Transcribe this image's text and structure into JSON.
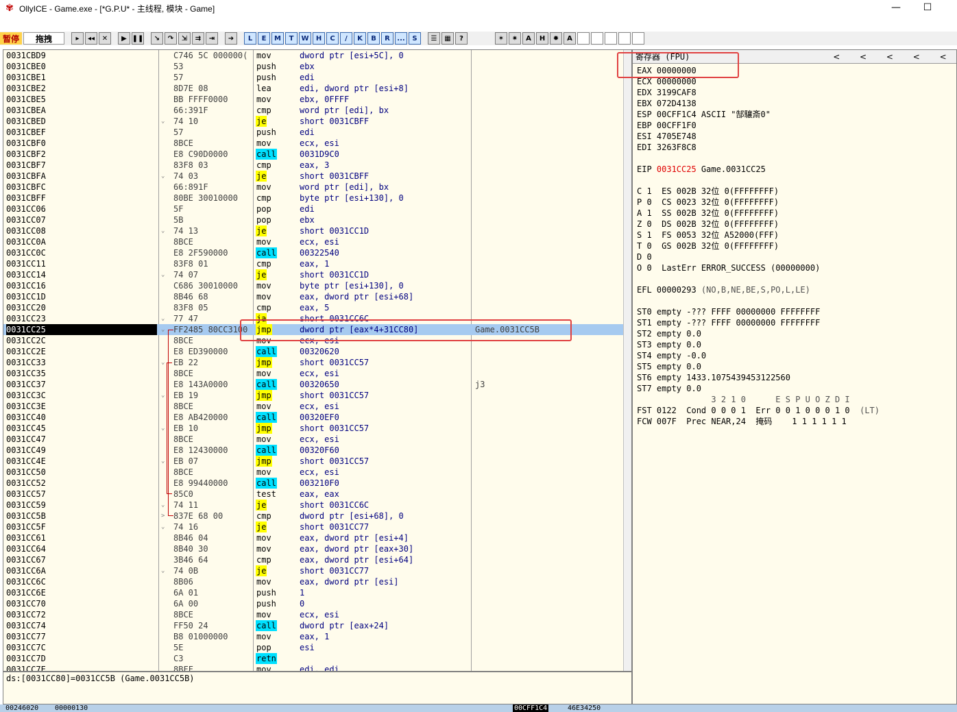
{
  "window": {
    "title": "OllyICE - Game.exe - [*G.P.U* - 主线程, 模块 - Game]",
    "minimize": "—",
    "maximize": "☐"
  },
  "toolbar": {
    "state_label": "暂停",
    "drag_label": "拖拽",
    "letters": [
      "L",
      "E",
      "M",
      "T",
      "W",
      "H",
      "C",
      "/",
      "K",
      "B",
      "R",
      "...",
      "S"
    ]
  },
  "disasm": {
    "rows": [
      {
        "a": "0031CBD9",
        "h": "C746 5C 000000(",
        "m": "mov",
        "o": "dword ptr [esi+5C], 0"
      },
      {
        "a": "0031CBE0",
        "h": "53",
        "m": "push",
        "o": "ebx"
      },
      {
        "a": "0031CBE1",
        "h": "57",
        "m": "push",
        "o": "edi"
      },
      {
        "a": "0031CBE2",
        "h": "8D7E 08",
        "m": "lea",
        "o": "edi, dword ptr [esi+8]"
      },
      {
        "a": "0031CBE5",
        "h": "BB FFFF0000",
        "m": "mov",
        "o": "ebx, 0FFFF"
      },
      {
        "a": "0031CBEA",
        "h": "66:391F",
        "m": "cmp",
        "o": "word ptr [edi], bx"
      },
      {
        "a": "0031CBED",
        "h": "74 10",
        "m": "je",
        "o": "short 0031CBFF",
        "t": "jmp",
        "ar": "⌄"
      },
      {
        "a": "0031CBEF",
        "h": "57",
        "m": "push",
        "o": "edi"
      },
      {
        "a": "0031CBF0",
        "h": "8BCE",
        "m": "mov",
        "o": "ecx, esi"
      },
      {
        "a": "0031CBF2",
        "h": "E8 C90D0000",
        "m": "call",
        "o": "0031D9C0",
        "t": "call"
      },
      {
        "a": "0031CBF7",
        "h": "83F8 03",
        "m": "cmp",
        "o": "eax, 3"
      },
      {
        "a": "0031CBFA",
        "h": "74 03",
        "m": "je",
        "o": "short 0031CBFF",
        "t": "jmp",
        "ar": "⌄"
      },
      {
        "a": "0031CBFC",
        "h": "66:891F",
        "m": "mov",
        "o": "word ptr [edi], bx"
      },
      {
        "a": "0031CBFF",
        "h": "80BE 30010000",
        "m": "cmp",
        "o": "byte ptr [esi+130], 0"
      },
      {
        "a": "0031CC06",
        "h": "5F",
        "m": "pop",
        "o": "edi"
      },
      {
        "a": "0031CC07",
        "h": "5B",
        "m": "pop",
        "o": "ebx"
      },
      {
        "a": "0031CC08",
        "h": "74 13",
        "m": "je",
        "o": "short 0031CC1D",
        "t": "jmp",
        "ar": "⌄"
      },
      {
        "a": "0031CC0A",
        "h": "8BCE",
        "m": "mov",
        "o": "ecx, esi"
      },
      {
        "a": "0031CC0C",
        "h": "E8 2F590000",
        "m": "call",
        "o": "00322540",
        "t": "call"
      },
      {
        "a": "0031CC11",
        "h": "83F8 01",
        "m": "cmp",
        "o": "eax, 1"
      },
      {
        "a": "0031CC14",
        "h": "74 07",
        "m": "je",
        "o": "short 0031CC1D",
        "t": "jmp",
        "ar": "⌄"
      },
      {
        "a": "0031CC16",
        "h": "C686 30010000",
        "m": "mov",
        "o": "byte ptr [esi+130], 0"
      },
      {
        "a": "0031CC1D",
        "h": "8B46 68",
        "m": "mov",
        "o": "eax, dword ptr [esi+68]"
      },
      {
        "a": "0031CC20",
        "h": "83F8 05",
        "m": "cmp",
        "o": "eax, 5"
      },
      {
        "a": "0031CC23",
        "h": "77 47",
        "m": "ja",
        "o": "short 0031CC6C",
        "t": "jmp",
        "ar": "⌄"
      },
      {
        "a": "0031CC25",
        "h": "FF2485 80CC3100",
        "m": "jmp",
        "o": "dword ptr [eax*4+31CC80]",
        "t": "jmp",
        "c": "Game.0031CC5B",
        "sel": true,
        "ar": "⌄"
      },
      {
        "a": "0031CC2C",
        "h": "8BCE",
        "m": "mov",
        "o": "ecx, esi"
      },
      {
        "a": "0031CC2E",
        "h": "E8 ED390000",
        "m": "call",
        "o": "00320620",
        "t": "call"
      },
      {
        "a": "0031CC33",
        "h": "EB 22",
        "m": "jmp",
        "o": "short 0031CC57",
        "t": "jmp",
        "ar": "⌄"
      },
      {
        "a": "0031CC35",
        "h": "8BCE",
        "m": "mov",
        "o": "ecx, esi"
      },
      {
        "a": "0031CC37",
        "h": "E8 143A0000",
        "m": "call",
        "o": "00320650",
        "t": "call",
        "c": "j3"
      },
      {
        "a": "0031CC3C",
        "h": "EB 19",
        "m": "jmp",
        "o": "short 0031CC57",
        "t": "jmp",
        "ar": "⌄"
      },
      {
        "a": "0031CC3E",
        "h": "8BCE",
        "m": "mov",
        "o": "ecx, esi"
      },
      {
        "a": "0031CC40",
        "h": "E8 AB420000",
        "m": "call",
        "o": "00320EF0",
        "t": "call"
      },
      {
        "a": "0031CC45",
        "h": "EB 10",
        "m": "jmp",
        "o": "short 0031CC57",
        "t": "jmp",
        "ar": "⌄"
      },
      {
        "a": "0031CC47",
        "h": "8BCE",
        "m": "mov",
        "o": "ecx, esi"
      },
      {
        "a": "0031CC49",
        "h": "E8 12430000",
        "m": "call",
        "o": "00320F60",
        "t": "call"
      },
      {
        "a": "0031CC4E",
        "h": "EB 07",
        "m": "jmp",
        "o": "short 0031CC57",
        "t": "jmp",
        "ar": "⌄"
      },
      {
        "a": "0031CC50",
        "h": "8BCE",
        "m": "mov",
        "o": "ecx, esi"
      },
      {
        "a": "0031CC52",
        "h": "E8 99440000",
        "m": "call",
        "o": "003210F0",
        "t": "call"
      },
      {
        "a": "0031CC57",
        "h": "85C0",
        "m": "test",
        "o": "eax, eax"
      },
      {
        "a": "0031CC59",
        "h": "74 11",
        "m": "je",
        "o": "short 0031CC6C",
        "t": "jmp",
        "ar": "⌄"
      },
      {
        "a": "0031CC5B",
        "h": "837E 68 00",
        "m": "cmp",
        "o": "dword ptr [esi+68], 0",
        "ar": ">"
      },
      {
        "a": "0031CC5F",
        "h": "74 16",
        "m": "je",
        "o": "short 0031CC77",
        "t": "jmp",
        "ar": "⌄"
      },
      {
        "a": "0031CC61",
        "h": "8B46 04",
        "m": "mov",
        "o": "eax, dword ptr [esi+4]"
      },
      {
        "a": "0031CC64",
        "h": "8B40 30",
        "m": "mov",
        "o": "eax, dword ptr [eax+30]"
      },
      {
        "a": "0031CC67",
        "h": "3B46 64",
        "m": "cmp",
        "o": "eax, dword ptr [esi+64]"
      },
      {
        "a": "0031CC6A",
        "h": "74 0B",
        "m": "je",
        "o": "short 0031CC77",
        "t": "jmp",
        "ar": "⌄"
      },
      {
        "a": "0031CC6C",
        "h": "8B06",
        "m": "mov",
        "o": "eax, dword ptr [esi]"
      },
      {
        "a": "0031CC6E",
        "h": "6A 01",
        "m": "push",
        "o": "1"
      },
      {
        "a": "0031CC70",
        "h": "6A 00",
        "m": "push",
        "o": "0"
      },
      {
        "a": "0031CC72",
        "h": "8BCE",
        "m": "mov",
        "o": "ecx, esi"
      },
      {
        "a": "0031CC74",
        "h": "FF50 24",
        "m": "call",
        "o": "dword ptr [eax+24]",
        "t": "call"
      },
      {
        "a": "0031CC77",
        "h": "B8 01000000",
        "m": "mov",
        "o": "eax, 1"
      },
      {
        "a": "0031CC7C",
        "h": "5E",
        "m": "pop",
        "o": "esi"
      },
      {
        "a": "0031CC7D",
        "h": "C3",
        "m": "retn",
        "o": "",
        "t": "ret"
      },
      {
        "a": "0031CC7E",
        "h": "8BFF",
        "m": "mov",
        "o": "edi, edi"
      }
    ],
    "info": "ds:[0031CC80]=0031CC5B (Game.0031CC5B)"
  },
  "registers": {
    "header": "寄存器 (FPU)",
    "nav": [
      "<",
      "<",
      "<",
      "<",
      "<"
    ],
    "lines": [
      {
        "t": "EAX 00000000"
      },
      {
        "t": "ECX 00000000"
      },
      {
        "t": "EDX 3199CAF8"
      },
      {
        "t": "EBX 072D4138"
      },
      {
        "t": "ESP 00CFF1C4 ASCII \"郜驤斎0\""
      },
      {
        "t": "EBP 00CFF1F0"
      },
      {
        "t": "ESI 4705E748"
      },
      {
        "t": "EDI 3263F8C8"
      },
      {
        "t": ""
      },
      {
        "t": "EIP ",
        "red": "0031CC25",
        "rest": " Game.0031CC25"
      },
      {
        "t": ""
      },
      {
        "t": "C 1  ES 002B 32位 0(FFFFFFFF)"
      },
      {
        "t": "P 0  CS 0023 32位 0(FFFFFFFF)"
      },
      {
        "t": "A 1  SS 002B 32位 0(FFFFFFFF)"
      },
      {
        "t": "Z 0  DS 002B 32位 0(FFFFFFFF)"
      },
      {
        "t": "S 1  FS 0053 32位 A52000(FFF)"
      },
      {
        "t": "T 0  GS 002B 32位 0(FFFFFFFF)"
      },
      {
        "t": "D 0"
      },
      {
        "t": "O 0  LastErr ERROR_SUCCESS (00000000)"
      },
      {
        "t": ""
      },
      {
        "t": "EFL 00000293 ",
        "gray": "(NO,B,NE,BE,S,PO,L,LE)"
      },
      {
        "t": ""
      },
      {
        "t": "ST0 empty -??? FFFF 00000000 FFFFFFFF"
      },
      {
        "t": "ST1 empty -??? FFFF 00000000 FFFFFFFF"
      },
      {
        "t": "ST2 empty 0.0"
      },
      {
        "t": "ST3 empty 0.0"
      },
      {
        "t": "ST4 empty -0.0"
      },
      {
        "t": "ST5 empty 0.0"
      },
      {
        "t": "ST6 empty 1433.1075439453122560"
      },
      {
        "t": "ST7 empty 0.0"
      },
      {
        "t": "               3 2 1 0      E S P U O Z D I",
        "gray_line": true
      },
      {
        "t": "FST 0122  Cond 0 0 0 1  Err 0 0 1 0 0 0 1 0  ",
        "gray": "(LT)"
      },
      {
        "t": "FCW 007F  Prec NEAR,24  掩码    1 1 1 1 1 1"
      }
    ]
  },
  "statusbar": {
    "left1": "00246020",
    "left2": "00000130",
    "mid": "00CFF1C4",
    "right": "46E34250"
  }
}
